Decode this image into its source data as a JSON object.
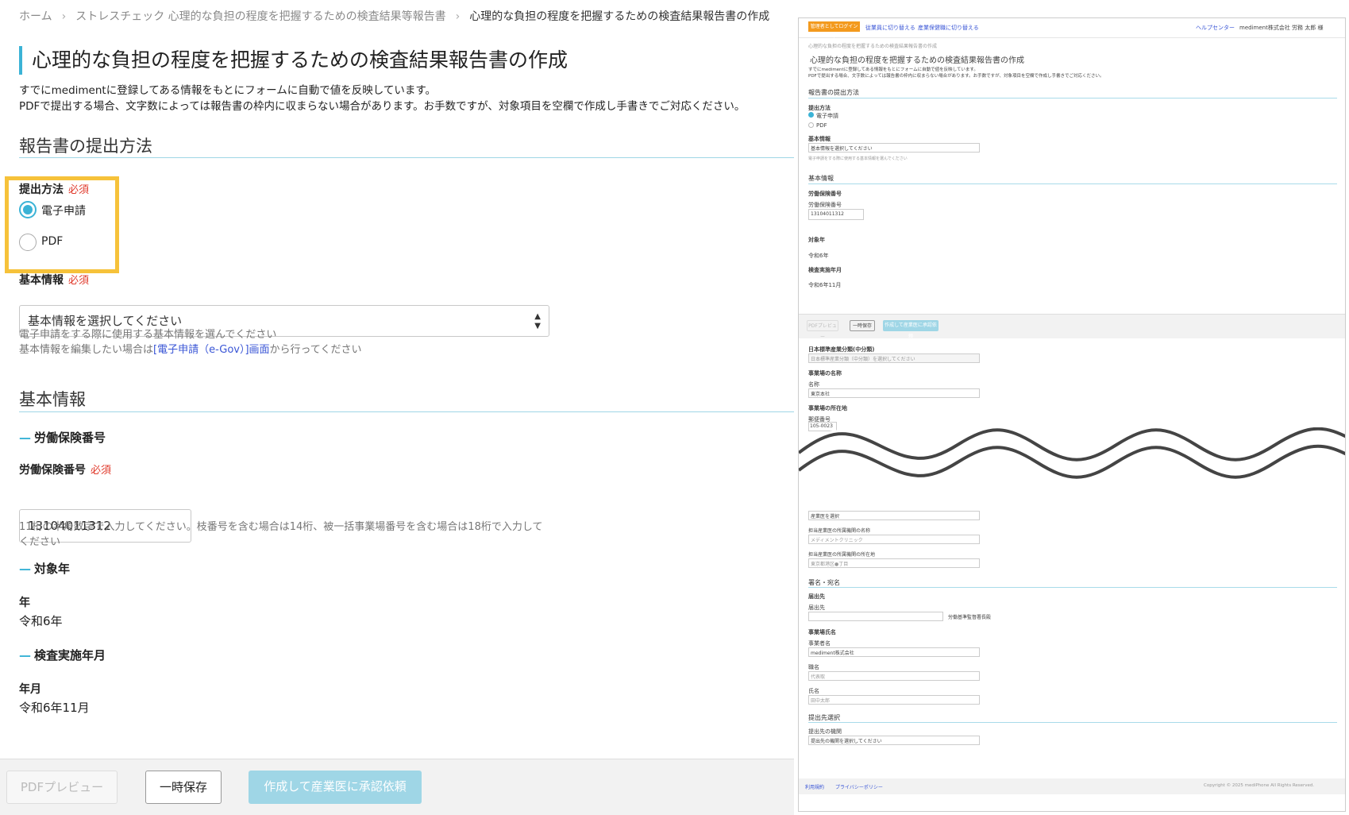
{
  "breadcrumb": {
    "home": "ホーム",
    "parent": "ストレスチェック 心理的な負担の程度を把握するための検査結果等報告書",
    "current": "心理的な負担の程度を把握するための検査結果報告書の作成"
  },
  "page_title": "心理的な負担の程度を把握するための検査結果報告書の作成",
  "intro": {
    "line1": "すでにmedimentに登録してある情報をもとにフォームに自動で値を反映しています。",
    "line2": "PDFで提出する場合、文字数によっては報告書の枠内に収まらない場合があります。お手数ですが、対象項目を空欄で作成し手書きでご対応ください。"
  },
  "submission": {
    "section_title": "報告書の提出方法",
    "method_label": "提出方法",
    "required": "必須",
    "options": [
      "電子申請",
      "PDF"
    ],
    "selected": "電子申請",
    "basic_info_label": "基本情報",
    "basic_info_select": "基本情報を選択してください",
    "help1": "電子申請をする際に使用する基本情報を選んでください",
    "help2_pre": "基本情報を編集したい場合は",
    "help2_link": "[電子申請（e-Gov）]画面",
    "help2_post": "から行ってください"
  },
  "basic": {
    "section_title": "基本情報",
    "insurance_heading": "労働保険番号",
    "insurance_label": "労働保険番号",
    "insurance_value": "13104011312",
    "insurance_help1": "11桁の半角数字で入力してください。枝番号を含む場合は14桁、被一括事業場番号を含む場合は18桁で入力して",
    "insurance_help2": "ください",
    "target_year_heading": "対象年",
    "year_label": "年",
    "year_value": "令和6年",
    "exam_heading": "検査実施年月",
    "yearmonth_label": "年月",
    "yearmonth_value": "令和6年11月"
  },
  "buttons": {
    "preview": "PDFプレビュー",
    "save": "一時保存",
    "submit": "作成して産業医に承認依頼"
  },
  "thumbnail": {
    "top_orange": "管理者としてログイン中",
    "top_link1": "従業員に切り替える",
    "top_link2": "産業保健職に切り替える",
    "help_center": "ヘルプセンター",
    "user": "mediment株式会社 労務 太郎 様",
    "industry_label": "日本標準産業分類(中分類)",
    "industry_select": "日本標準産業分類（中分類）を選択してください",
    "workplace_name_heading": "事業場の名称",
    "name_label": "名称",
    "name_value": "東京本社",
    "workplace_addr_heading": "事業場の所在地",
    "postal_label": "郵便番号",
    "postal_value": "105-0023",
    "doctor_select": "産業医を選択",
    "org_name_label": "担当産業医の所属機関の名称",
    "org_name_placeholder": "メディメントクリニック",
    "org_addr_label": "担当産業医の所属機関の所在地",
    "org_addr_placeholder": "東京都港区●丁目",
    "sign_section": "署名・宛名",
    "dest_heading": "届出先",
    "dest_label": "届出先",
    "dest_suffix": "労働基準監督署長殿",
    "employer_heading": "事業場氏名",
    "company_label": "事業者名",
    "company_value": "mediment株式会社",
    "title_label": "職名",
    "title_placeholder": "代表取",
    "person_label": "氏名",
    "person_placeholder": "田中太郎",
    "dest_select_section": "提出先選択",
    "dest_select_label": "提出先の機関",
    "dest_select_value": "提出先の機関を選択してください",
    "footer_terms": "利用規約",
    "footer_privacy": "プライバシーポリシー",
    "copyright": "Copyright © 2025 mediPhone All Rights Reserved."
  }
}
